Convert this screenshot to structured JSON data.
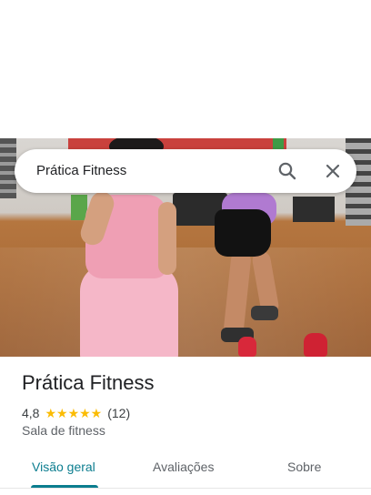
{
  "search": {
    "query": "Prática Fitness",
    "search_icon": "search-icon",
    "close_icon": "close-icon"
  },
  "place": {
    "title": "Prática Fitness",
    "rating": "4,8",
    "stars": "★★★★★",
    "review_count": "(12)",
    "category": "Sala de fitness"
  },
  "tabs": [
    {
      "label": "Visão geral",
      "active": true
    },
    {
      "label": "Avaliações",
      "active": false
    },
    {
      "label": "Sobre",
      "active": false
    }
  ],
  "colors": {
    "accent": "#0b7d8f",
    "star": "#fbbc04",
    "text": "#202124",
    "muted": "#5f6368"
  }
}
